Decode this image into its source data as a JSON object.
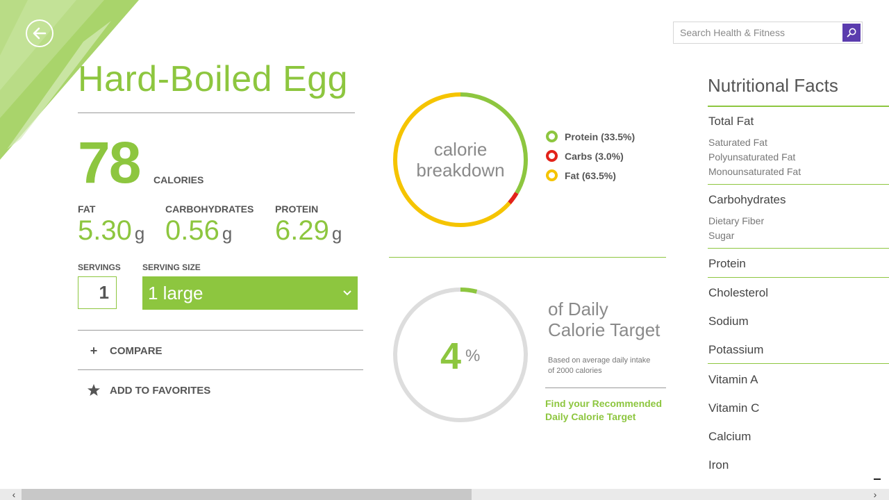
{
  "search": {
    "placeholder": "Search Health & Fitness"
  },
  "food": {
    "title": "Hard-Boiled Egg",
    "calories": "78",
    "calories_label": "CALORIES"
  },
  "macros": [
    {
      "label": "FAT",
      "value": "5.30",
      "unit": "g"
    },
    {
      "label": "CARBOHYDRATES",
      "value": "0.56",
      "unit": "g"
    },
    {
      "label": "PROTEIN",
      "value": "6.29",
      "unit": "g"
    }
  ],
  "serving": {
    "servings_label": "SERVINGS",
    "servings_value": "1",
    "size_label": "SERVING SIZE",
    "size_value": "1 large"
  },
  "actions": {
    "compare": "COMPARE",
    "favorites": "ADD TO FAVORITES"
  },
  "breakdown": {
    "center_line1": "calorie",
    "center_line2": "breakdown",
    "legend": [
      {
        "label": "Protein (33.5%)",
        "color": "#8dc63f",
        "percent": 33.5
      },
      {
        "label": "Carbs (3.0%)",
        "color": "#e2231a",
        "percent": 3.0
      },
      {
        "label": "Fat (63.5%)",
        "color": "#f5c400",
        "percent": 63.5
      }
    ]
  },
  "daily": {
    "percent": "4",
    "percent_value": 4,
    "percent_sign": "%",
    "title_line1": "of Daily",
    "title_line2": "Calorie Target",
    "note_line1": "Based on average daily intake",
    "note_line2": "of 2000 calories",
    "link_line1": "Find your Recommended",
    "link_line2": "Daily Calorie Target"
  },
  "nutrition": {
    "title": "Nutritional Facts",
    "total_fat": "Total Fat",
    "saturated_fat": "Saturated Fat",
    "polyunsaturated_fat": "Polyunsaturated Fat",
    "monounsaturated_fat": "Monounsaturated Fat",
    "carbohydrates": "Carbohydrates",
    "dietary_fiber": "Dietary Fiber",
    "sugar": "Sugar",
    "protein": "Protein",
    "cholesterol": "Cholesterol",
    "sodium": "Sodium",
    "potassium": "Potassium",
    "vitamin_a": "Vitamin A",
    "vitamin_c": "Vitamin C",
    "calcium": "Calcium",
    "iron": "Iron"
  },
  "colors": {
    "accent": "#8dc63f",
    "search_button": "#5b3cae",
    "ring_track": "#dddddd"
  }
}
